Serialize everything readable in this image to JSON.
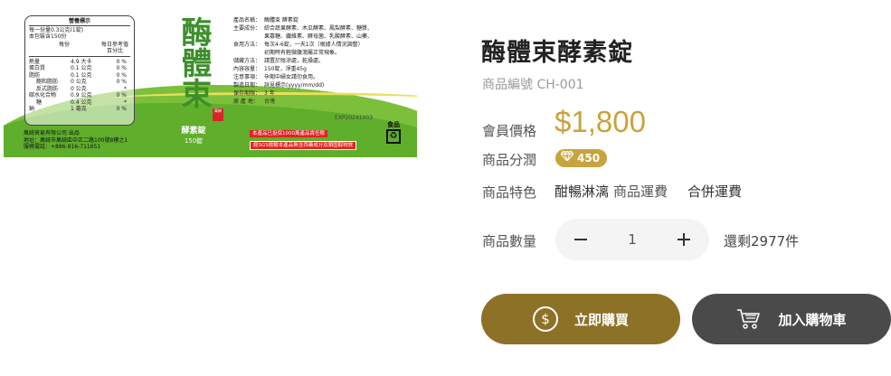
{
  "product_image": {
    "nutrition": {
      "title": "營養標示",
      "serving": "每一份量0.3公克(1錠)",
      "servings": "本包裝含150份",
      "header_per": "每份",
      "header_pct": "每日參考值百分比",
      "rows": [
        {
          "name": "熱量",
          "value": "4.9 大卡",
          "pct": "0 %"
        },
        {
          "name": "蛋白質",
          "value": "0.1 公克",
          "pct": "0 %"
        },
        {
          "name": "脂肪",
          "value": "0.1 公克",
          "pct": "0 %"
        },
        {
          "name": "飽和脂肪",
          "value": "0 公克",
          "pct": "0 %"
        },
        {
          "name": "反式脂肪",
          "value": "0 公克",
          "pct": "*"
        },
        {
          "name": "碳水化合物",
          "value": "0.9 公克",
          "pct": "0 %"
        },
        {
          "name": "糖",
          "value": "0.4 公克",
          "pct": "*"
        },
        {
          "name": "鈉",
          "value": "1 毫克",
          "pct": "0 %"
        }
      ]
    },
    "company_lines": [
      "萬綺貿易有限公司 出品",
      "地址：萬綺市萬綺區中正二路100號8樓之1",
      "服務電話：+886-916-711651"
    ],
    "big_chars": "酶體束",
    "stamp_text": "萬綺",
    "sub_name": "酵素錠",
    "sub_qty": "150錠",
    "spec_rows": [
      {
        "k": "產品名稱：",
        "v": "酶體束 酵素錠"
      },
      {
        "k": "主要成份：",
        "v": "綜合蔬果酵素、木瓜酵素、鳳梨酵素、糖漿、"
      },
      {
        "k": "",
        "v": "果寡糖、纖維素、酵母菌、乳酸酵素、山藥、"
      },
      {
        "k": "食用方法：",
        "v": "每次4-6錠，一天1次（根據人情況調整）"
      },
      {
        "k": "",
        "v": "初期時有輕微腹瀉屬正常現象。"
      },
      {
        "k": "儲藏方法：",
        "v": "請置於陰涼處，乾燥處。"
      },
      {
        "k": "內容容量：",
        "v": "150錠，淨重45g"
      },
      {
        "k": "注意事項：",
        "v": "孕期中婦女請勿食用。"
      },
      {
        "k": "製造日期：",
        "v": "詳見標示(yyyy/mm/dd)"
      },
      {
        "k": "保存期限：",
        "v": "3 年"
      },
      {
        "k": "原 產 地：",
        "v": "台灣"
      }
    ],
    "exp": "EXP20241003",
    "food_label": "食品",
    "warning_1": "本產品已投保1000萬產品責任險",
    "warning_2": "經SGS檢驗本產品無含西藥成分及類固醇物質"
  },
  "product": {
    "title": "酶體束酵素錠",
    "sku": "商品編號 CH-001",
    "price_label": "會員價格",
    "price": "$1,800",
    "points_label": "商品分潤",
    "points_value": "450",
    "feature_label": "商品特色",
    "feature_value": "酣暢淋漓",
    "shipping_label": "商品運費",
    "shipping_value": "合併運費",
    "qty_label": "商品數量",
    "qty_value": "1",
    "stock": "還剩2977件",
    "buy_now": "立即購買",
    "add_to_cart": "加入購物車"
  },
  "colors": {
    "accent_gold": "#c9a33a",
    "buy_button": "#8d7126",
    "cart_button": "#4a4a4a",
    "label_green": "#5fae2c"
  }
}
